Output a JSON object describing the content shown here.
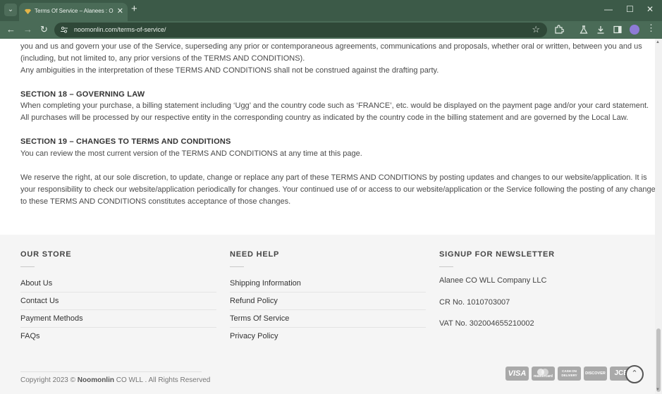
{
  "browser": {
    "tab_title": "Terms Of Service – Alanees : O",
    "url": "noomonlin.com/terms-of-service/",
    "new_tab_glyph": "+",
    "tab_close_glyph": "✕",
    "window_controls": [
      "—",
      "☐",
      "✕"
    ]
  },
  "article": {
    "paragraphs": [
      "you and us and govern your use of the Service, superseding any prior or contemporaneous agreements, communications and proposals, whether oral or written, between you and us",
      "(including, but not limited to, any prior versions of the TERMS AND CONDITIONS).",
      "Any ambiguities in the interpretation of these TERMS AND CONDITIONS shall not be construed against the drafting party."
    ],
    "section18": {
      "heading": "SECTION 18 – GOVERNING LAW",
      "line1": "When completing your purchase, a billing statement including ‘Ugg’ and the country code such as ‘FRANCE’, etc. would be displayed on the payment page and/or your card statement.",
      "line2": "All purchases will be processed by our respective entity in the corresponding country as indicated by the country code in the billing statement and are governed by the Local Law."
    },
    "section19": {
      "heading": "SECTION 19 – CHANGES TO TERMS AND CONDITIONS",
      "line1": "You can review the most current version of the TERMS AND CONDITIONS at any time at this page.",
      "para_line1": "We reserve the right, at our sole discretion, to update, change or replace any part of these TERMS AND CONDITIONS by posting updates and changes to our website/application. It is",
      "para_line2": "your responsibility to check our website/application periodically for changes. Your continued use of or access to our website/application or the Service following the posting of any changes",
      "para_line3": "to these TERMS AND CONDITIONS constitutes acceptance of those changes."
    }
  },
  "footer": {
    "our_store": {
      "heading": "OUR STORE",
      "links": [
        "About Us",
        "Contact Us",
        "Payment Methods",
        "FAQs"
      ]
    },
    "need_help": {
      "heading": "NEED HELP",
      "links": [
        "Shipping Information",
        "Refund Policy",
        "Terms Of Service",
        "Privacy Policy"
      ]
    },
    "newsletter": {
      "heading": "SIGNUP FOR NEWSLETTER",
      "company": "Alanee CO WLL Company LLC",
      "cr": "CR No. 1010703007",
      "vat": "VAT No. 302004655210002"
    },
    "copyright_prefix": "Copyright 2023 ©",
    "copyright_brand": "Noomonlin",
    "copyright_suffix": "CO WLL . All Rights Reserved",
    "payment_methods": [
      "VISA",
      "mastercard",
      "CASH ON DELIVERY",
      "DISCOVER",
      "JCB"
    ]
  },
  "colors": {
    "tab_bar": "#3c5a48",
    "toolbar": "#4a6b57",
    "footer_bg": "#f5f5f5"
  }
}
